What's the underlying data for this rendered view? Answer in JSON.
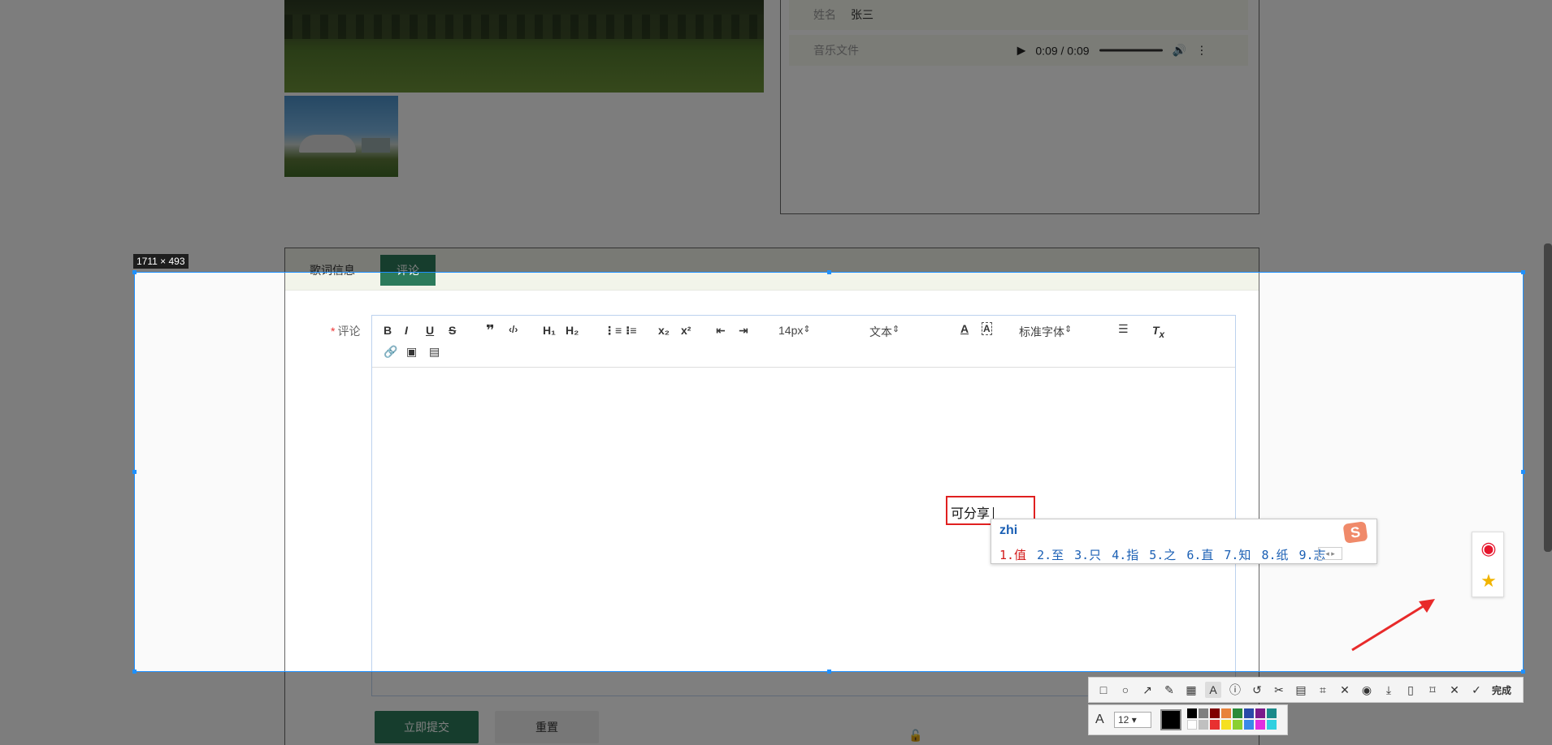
{
  "info": {
    "name_label": "姓名",
    "name_value": "张三",
    "music_label": "音乐文件",
    "audio_time": "0:09 / 0:09"
  },
  "tabs": [
    "歌词信息",
    "评论"
  ],
  "form": {
    "field_label": "评论",
    "required_mark": "*",
    "submit_label": "立即提交",
    "reset_label": "重置"
  },
  "editor_toolbar": {
    "font_size": "14px",
    "block_format": "文本",
    "font_family": "标准字体",
    "h1": "H₁",
    "h2": "H₂"
  },
  "screenshot_tool": {
    "selection_size": "1711 × 493",
    "annotation_text": "可分享",
    "done_label": "完成",
    "font_size_value": "12",
    "accent_color": "#1e90ff"
  },
  "ime": {
    "pinyin": "zhi",
    "candidates": [
      "1.值",
      "2.至",
      "3.只",
      "4.指",
      "5.之",
      "6.直",
      "7.知",
      "8.纸",
      "9.志"
    ],
    "logo": "S"
  }
}
